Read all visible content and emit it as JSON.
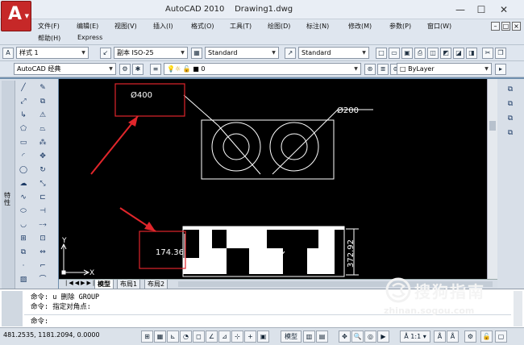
{
  "window": {
    "app_name": "AutoCAD 2010",
    "document": "Drawing1.dwg",
    "minimize": "—",
    "maximize": "☐",
    "close": "✕"
  },
  "menu": {
    "items": [
      "文件(F)",
      "编辑(E)",
      "视图(V)",
      "插入(I)",
      "格式(O)",
      "工具(T)",
      "绘图(D)",
      "标注(N)",
      "修改(M)",
      "参数(P)",
      "窗口(W)"
    ],
    "items_row2": [
      "帮助(H)",
      "Express"
    ]
  },
  "toolbar1": {
    "text_style": "样式 1",
    "dim_style": "副本 ISO-25",
    "table_style": "Standard",
    "multileader_style": "Standard"
  },
  "toolbar2": {
    "workspace": "AutoCAD 经典",
    "layer": "0",
    "color": "ByLayer"
  },
  "palette": {
    "label": "特性"
  },
  "drawing": {
    "circle_dim": "Ø200",
    "callout_dim": "Ø400",
    "linear_dim": "174.36",
    "vertical_dim": "372.92",
    "ucs_x": "X",
    "ucs_y": "Y",
    "accent_color": "#e0262b",
    "line_color": "#ffffff"
  },
  "layout_tabs": [
    "模型",
    "布局1",
    "布局2"
  ],
  "command": {
    "line1": "命令:  u 删除 GROUP",
    "line2": "命令: 指定对角点:",
    "prompt": "命令:"
  },
  "status": {
    "coords": "481.2535,  1181.2094,  0.0000",
    "model": "模型",
    "scale": "1:1"
  },
  "watermark": {
    "brand": "搜狗指南",
    "url": "zhinan.sogou.com"
  }
}
